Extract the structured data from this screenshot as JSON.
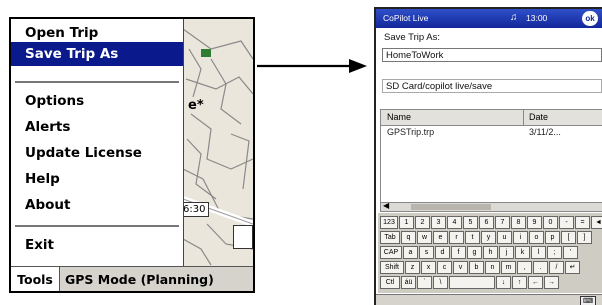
{
  "left_screen": {
    "menu_items": [
      {
        "label": "Open Trip"
      },
      {
        "label": "Save Trip As",
        "highlighted": true
      },
      {
        "label": "Options"
      },
      {
        "label": "Alerts"
      },
      {
        "label": "Update License"
      },
      {
        "label": "Help"
      },
      {
        "label": "About"
      },
      {
        "label": "Exit"
      }
    ],
    "map": {
      "label_right": "e*",
      "label_time": "6:30"
    },
    "taskbar": {
      "tools_label": "Tools",
      "mode_label": "GPS Mode (Planning)"
    }
  },
  "right_screen": {
    "titlebar": {
      "title": "CoPilot Live",
      "volume_icon": "speaker-icon",
      "clock": "13:00",
      "ok_label": "ok"
    },
    "save_label": "Save Trip As:",
    "filename_value": "HomeToWork",
    "path_value": "SD Card/copilot live/save",
    "file_list": {
      "columns": [
        "Name",
        "Date"
      ],
      "rows": [
        {
          "name": "GPSTrip.trp",
          "date": "3/11/2..."
        }
      ]
    },
    "keyboard": {
      "rows": [
        [
          "123",
          "1",
          "2",
          "3",
          "4",
          "5",
          "6",
          "7",
          "8",
          "9",
          "0",
          "-",
          "=",
          "◄"
        ],
        [
          "Tab",
          "q",
          "w",
          "e",
          "r",
          "t",
          "y",
          "u",
          "i",
          "o",
          "p",
          "[",
          "]"
        ],
        [
          "CAP",
          "a",
          "s",
          "d",
          "f",
          "g",
          "h",
          "j",
          "k",
          "l",
          ";",
          "'"
        ],
        [
          "Shift",
          "z",
          "x",
          "c",
          "v",
          "b",
          "n",
          "m",
          ",",
          ".",
          "/",
          "↵"
        ],
        [
          "Ctl",
          "áü",
          "`",
          "\\",
          "",
          "↓",
          "↑",
          "←",
          "→"
        ]
      ]
    }
  },
  "colors": {
    "menu_highlight": "#0a1a8c",
    "titlebar": "#2f4fc9"
  }
}
